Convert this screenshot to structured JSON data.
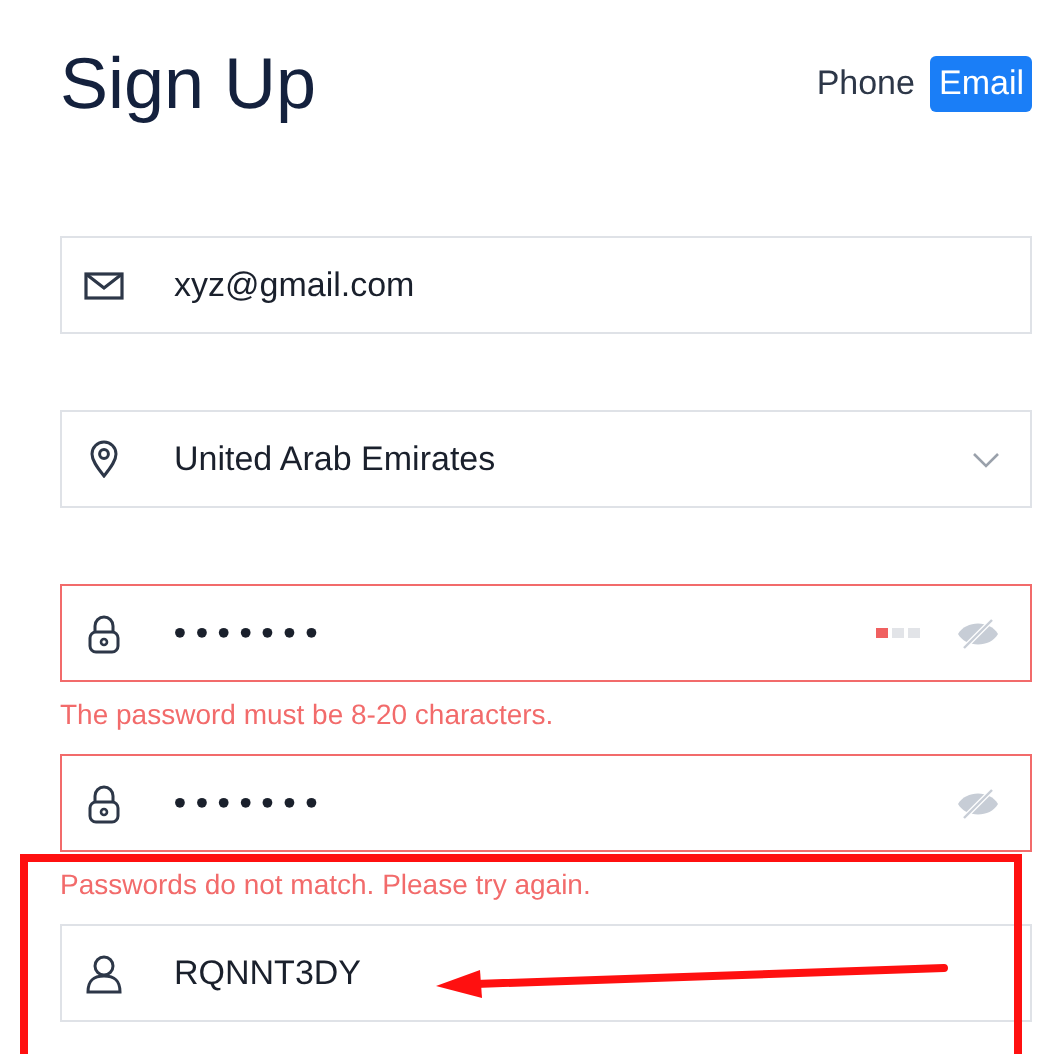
{
  "title": "Sign Up",
  "tabs": [
    {
      "label": "Phone",
      "selected": false
    },
    {
      "label": "Email",
      "selected": true
    }
  ],
  "fields": [
    {
      "kind": "email",
      "value": "xyz@gmail.com",
      "invalid": false
    },
    {
      "kind": "select",
      "value": "United Arab Emirates",
      "invalid": false
    },
    {
      "kind": "password",
      "value": "•••••••",
      "invalid": true,
      "level": 0.33,
      "error": "The password must be 8-20 characters."
    },
    {
      "kind": "password",
      "value": "•••••••",
      "invalid": true,
      "error": "Passwords do not match. Please try again."
    },
    {
      "kind": "referral",
      "value": "RQNNT3DY",
      "invalid": false
    }
  ],
  "annotation": {
    "kind": "highlight-with-arrow"
  }
}
